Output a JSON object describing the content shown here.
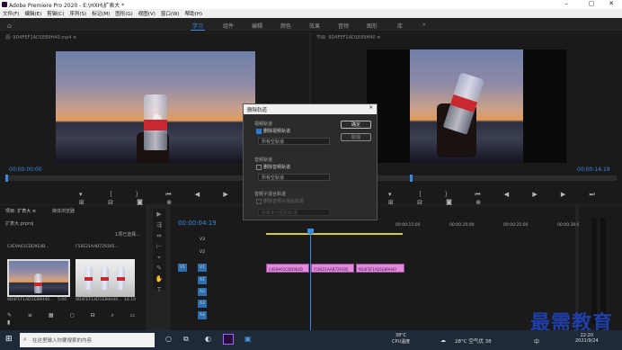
{
  "window": {
    "title": "Adobe Premiere Pro 2020 - E:\\HXH\\扩表大 *",
    "min": "–",
    "max": "▢",
    "close": "✕"
  },
  "menu": [
    "文件(F)",
    "编辑(E)",
    "剪辑(C)",
    "序列(S)",
    "标记(M)",
    "图形(G)",
    "视图(V)",
    "窗口(W)",
    "帮助(H)"
  ],
  "workspaces": {
    "active": "学习",
    "items": [
      "组件",
      "编辑",
      "颜色",
      "效果",
      "音频",
      "图形",
      "库"
    ],
    "more": "»"
  },
  "source": {
    "header": "源: 9D4FEF1AD1E89H40.mp4 ≡",
    "timecode": "00:00:00:00"
  },
  "program": {
    "header": "节目: 9D4FEF1AD1E89H40 ≡",
    "timecode": "00:00:14:19"
  },
  "dialog": {
    "title": "删除轨道",
    "close": "✕",
    "video_group": "视频轨道",
    "video_check": "删除视频轨道",
    "video_select": "所有空轨道",
    "audio_group": "音频轨道",
    "audio_check": "删除音频轨道",
    "audio_select": "所有空轨道",
    "sub_group": "音频子混合轨道",
    "sub_check": "删除音频子混合轨道",
    "sub_select": "所有未分配的轨道",
    "ok": "确定",
    "cancel": "取消"
  },
  "project": {
    "tabs": [
      "项目: 扩表大 ≡",
      "媒体浏览器"
    ],
    "file": "扩表大.prproj",
    "selection": "1项已选择...",
    "items": [
      {
        "name": "9D4FEF1AD1E89H40...",
        "duration": "5:00"
      },
      {
        "name": "9D4FEF1AD1E89H40...",
        "duration": "14:19"
      }
    ],
    "top_labels": [
      "C4E9A61CDD9E4B...",
      "F50E21AAB729305..."
    ]
  },
  "timeline": {
    "timecode": "00:00:04:19",
    "ticks": [
      "00:00:00",
      "00:00:15:00",
      "00:00:20:00",
      "00:00:25:00",
      "00:00:30:00"
    ],
    "video_tracks": [
      "V3",
      "V2",
      "V1"
    ],
    "audio_tracks": [
      "A1",
      "A2",
      "A3",
      "A4"
    ],
    "clips": [
      "C4E9A61CDD9E4D",
      "F50E21AAB729305",
      "9D4FEF1AD1E89H40"
    ]
  },
  "taskbar": {
    "search_placeholder": "在这里输入你要搜索的内容",
    "weather_temp": "38°C",
    "weather_label": "CPU温度",
    "air": "28°C 空气优 38",
    "ime": "中",
    "time": "22:20",
    "date": "2021/9/24"
  },
  "watermark": "最需教育"
}
